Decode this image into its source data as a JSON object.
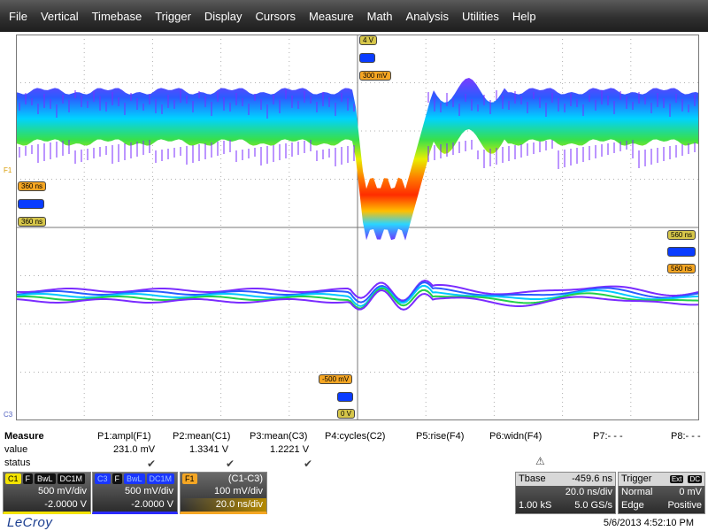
{
  "menu": [
    "File",
    "Vertical",
    "Timebase",
    "Trigger",
    "Display",
    "Cursors",
    "Measure",
    "Math",
    "Analysis",
    "Utilities",
    "Help"
  ],
  "trace_labels": {
    "f1": "F1",
    "c3": "C3"
  },
  "markers": {
    "top_4v": "4 V",
    "top_300mv": "300 mV",
    "left_360ns_a": "360 ns",
    "left_360ns_b": "360 ns",
    "right_560ns_a": "560 ns",
    "right_560ns_b": "560 ns",
    "bottom_minus500mv": "-500 mV",
    "bottom_0v": "0 V"
  },
  "measure": {
    "title": "Measure",
    "row_value": "value",
    "row_status": "status",
    "params": [
      {
        "label": "P1:ampl(F1)",
        "value": "231.0 mV",
        "status": "✔"
      },
      {
        "label": "P2:mean(C1)",
        "value": "1.3341 V",
        "status": "✔"
      },
      {
        "label": "P3:mean(C3)",
        "value": "1.2221 V",
        "status": "✔"
      },
      {
        "label": "P4:cycles(C2)",
        "value": "",
        "status": ""
      },
      {
        "label": "P5:rise(F4)",
        "value": "",
        "status": ""
      },
      {
        "label": "P6:widn(F4)",
        "value": "",
        "status": "⚠"
      },
      {
        "label": "P7:- - -",
        "value": "",
        "status": ""
      },
      {
        "label": "P8:- - -",
        "value": "",
        "status": ""
      }
    ]
  },
  "channels": {
    "c1": {
      "name": "C1",
      "flags": [
        "F",
        "BwL",
        "DC1M"
      ],
      "scale": "500 mV/div",
      "offset": "-2.0000 V"
    },
    "c3": {
      "name": "C3",
      "flags": [
        "F",
        "BwL",
        "DC1M"
      ],
      "scale": "500 mV/div",
      "offset": "-2.0000 V"
    },
    "f1": {
      "name": "F1",
      "expr": "(C1-C3)",
      "scale": "100 mV/div",
      "timebase": "20.0 ns/div"
    }
  },
  "timebase": {
    "label": "Tbase",
    "delay": "-459.6 ns",
    "tdiv": "20.0 ns/div",
    "samples": "1.00 kS",
    "rate": "5.0 GS/s"
  },
  "trigger": {
    "label": "Trigger",
    "flags": [
      "Ext",
      "DC"
    ],
    "mode": "Normal",
    "level": "0 mV",
    "type": "Edge",
    "slope": "Positive"
  },
  "footer": {
    "brand": "LeCroy",
    "datetime": "5/6/2013 4:52:10 PM"
  },
  "colors": {
    "c1": "#f3e300",
    "c3": "#1a36ff",
    "f1": "#f5a623",
    "menubar": "#303030"
  }
}
